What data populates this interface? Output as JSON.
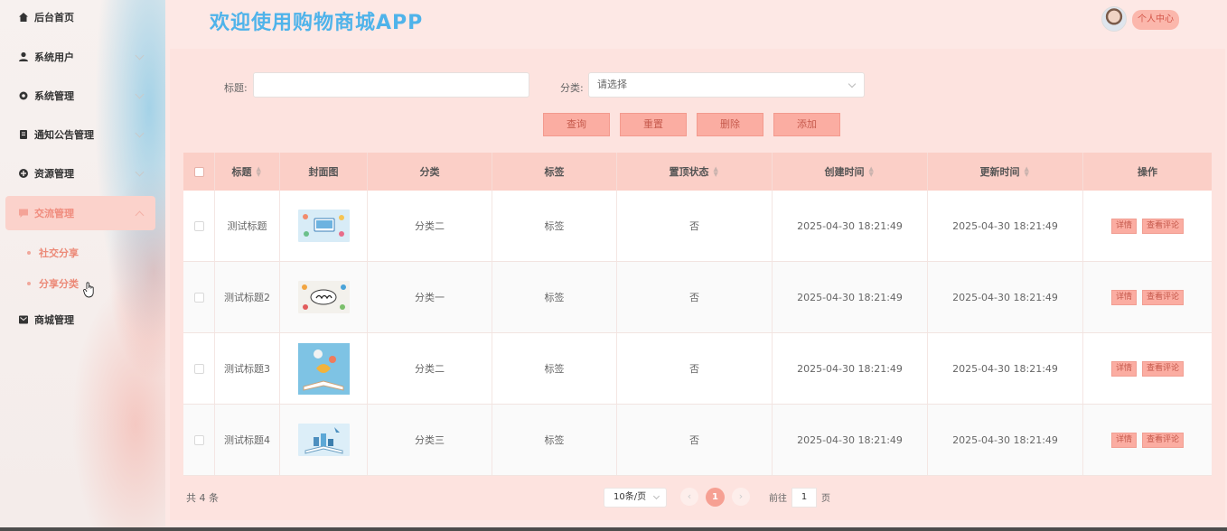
{
  "sidebar": {
    "items": [
      {
        "label": "后台首页",
        "icon": "home-icon"
      },
      {
        "label": "系统用户",
        "icon": "user-icon"
      },
      {
        "label": "系统管理",
        "icon": "gear-icon"
      },
      {
        "label": "通知公告管理",
        "icon": "notice-icon"
      },
      {
        "label": "资源管理",
        "icon": "plus-circle-icon"
      },
      {
        "label": "交流管理",
        "icon": "chat-icon"
      },
      {
        "label": "商城管理",
        "icon": "mail-icon"
      }
    ],
    "sub_items": [
      "社交分享",
      "分享分类"
    ]
  },
  "header": {
    "title": "欢迎使用购物商城APP",
    "user_center": "个人中心"
  },
  "search": {
    "title_label": "标题:",
    "title_value": "",
    "category_label": "分类:",
    "category_placeholder": "请选择"
  },
  "actions": {
    "query": "查询",
    "reset": "重置",
    "delete": "删除",
    "add": "添加"
  },
  "table": {
    "columns": [
      "标题",
      "封面图",
      "分类",
      "标签",
      "置顶状态",
      "创建时间",
      "更新时间",
      "操作"
    ],
    "rows": [
      {
        "title": "测试标题",
        "category": "分类二",
        "tag": "标签",
        "pinned": "否",
        "created": "2025-04-30 18:21:49",
        "updated": "2025-04-30 18:21:49"
      },
      {
        "title": "测试标题2",
        "category": "分类一",
        "tag": "标签",
        "pinned": "否",
        "created": "2025-04-30 18:21:49",
        "updated": "2025-04-30 18:21:49"
      },
      {
        "title": "测试标题3",
        "category": "分类二",
        "tag": "标签",
        "pinned": "否",
        "created": "2025-04-30 18:21:49",
        "updated": "2025-04-30 18:21:49"
      },
      {
        "title": "测试标题4",
        "category": "分类三",
        "tag": "标签",
        "pinned": "否",
        "created": "2025-04-30 18:21:49",
        "updated": "2025-04-30 18:21:49"
      }
    ],
    "detail_label": "详情",
    "comment_label": "查看评论"
  },
  "pagination": {
    "total": "共 4 条",
    "page_size": "10条/页",
    "current_page": "1",
    "goto_prefix": "前往",
    "goto_value": "1",
    "goto_suffix": "页"
  },
  "colors": {
    "accent": "#f6a093",
    "title_blue": "#4fb3ea",
    "header_row": "#fbcfc7"
  }
}
